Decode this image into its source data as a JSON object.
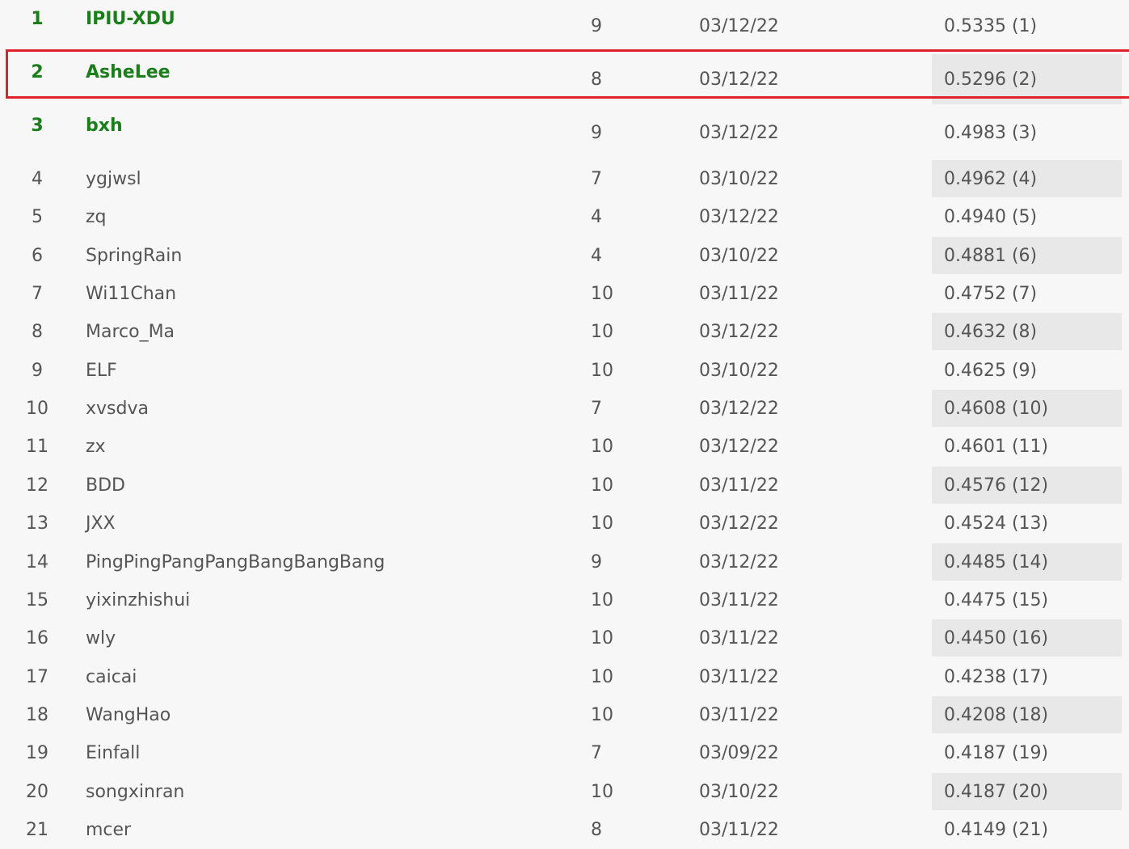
{
  "colors": {
    "background": "#f7f7f7",
    "text": "#555555",
    "top_rank_text": "#1a7f1a",
    "alt_score_bg": "#e8e8e8",
    "highlight_border": "#e0202a"
  },
  "leaderboard": {
    "highlighted_rank": "2",
    "rows": [
      {
        "rank": "1",
        "team": "IPIU-XDU",
        "entries": "9",
        "date": "03/12/22",
        "score": "0.5335 (1)"
      },
      {
        "rank": "2",
        "team": "AsheLee",
        "entries": "8",
        "date": "03/12/22",
        "score": "0.5296 (2)"
      },
      {
        "rank": "3",
        "team": "bxh",
        "entries": "9",
        "date": "03/12/22",
        "score": "0.4983 (3)"
      },
      {
        "rank": "4",
        "team": "ygjwsl",
        "entries": "7",
        "date": "03/10/22",
        "score": "0.4962 (4)"
      },
      {
        "rank": "5",
        "team": "zq",
        "entries": "4",
        "date": "03/12/22",
        "score": "0.4940 (5)"
      },
      {
        "rank": "6",
        "team": "SpringRain",
        "entries": "4",
        "date": "03/10/22",
        "score": "0.4881 (6)"
      },
      {
        "rank": "7",
        "team": "Wi11Chan",
        "entries": "10",
        "date": "03/11/22",
        "score": "0.4752 (7)"
      },
      {
        "rank": "8",
        "team": "Marco_Ma",
        "entries": "10",
        "date": "03/12/22",
        "score": "0.4632 (8)"
      },
      {
        "rank": "9",
        "team": "ELF",
        "entries": "10",
        "date": "03/10/22",
        "score": "0.4625 (9)"
      },
      {
        "rank": "10",
        "team": "xvsdva",
        "entries": "7",
        "date": "03/12/22",
        "score": "0.4608 (10)"
      },
      {
        "rank": "11",
        "team": "zx",
        "entries": "10",
        "date": "03/12/22",
        "score": "0.4601 (11)"
      },
      {
        "rank": "12",
        "team": "BDD",
        "entries": "10",
        "date": "03/11/22",
        "score": "0.4576 (12)"
      },
      {
        "rank": "13",
        "team": "JXX",
        "entries": "10",
        "date": "03/12/22",
        "score": "0.4524 (13)"
      },
      {
        "rank": "14",
        "team": "PingPingPangPangBangBangBang",
        "entries": "9",
        "date": "03/12/22",
        "score": "0.4485 (14)"
      },
      {
        "rank": "15",
        "team": "yixinzhishui",
        "entries": "10",
        "date": "03/11/22",
        "score": "0.4475 (15)"
      },
      {
        "rank": "16",
        "team": "wly",
        "entries": "10",
        "date": "03/11/22",
        "score": "0.4450 (16)"
      },
      {
        "rank": "17",
        "team": "caicai",
        "entries": "10",
        "date": "03/11/22",
        "score": "0.4238 (17)"
      },
      {
        "rank": "18",
        "team": "WangHao",
        "entries": "10",
        "date": "03/11/22",
        "score": "0.4208 (18)"
      },
      {
        "rank": "19",
        "team": "Einfall",
        "entries": "7",
        "date": "03/09/22",
        "score": "0.4187 (19)"
      },
      {
        "rank": "20",
        "team": "songxinran",
        "entries": "10",
        "date": "03/10/22",
        "score": "0.4187 (20)"
      },
      {
        "rank": "21",
        "team": "mcer",
        "entries": "8",
        "date": "03/11/22",
        "score": "0.4149 (21)"
      }
    ]
  }
}
